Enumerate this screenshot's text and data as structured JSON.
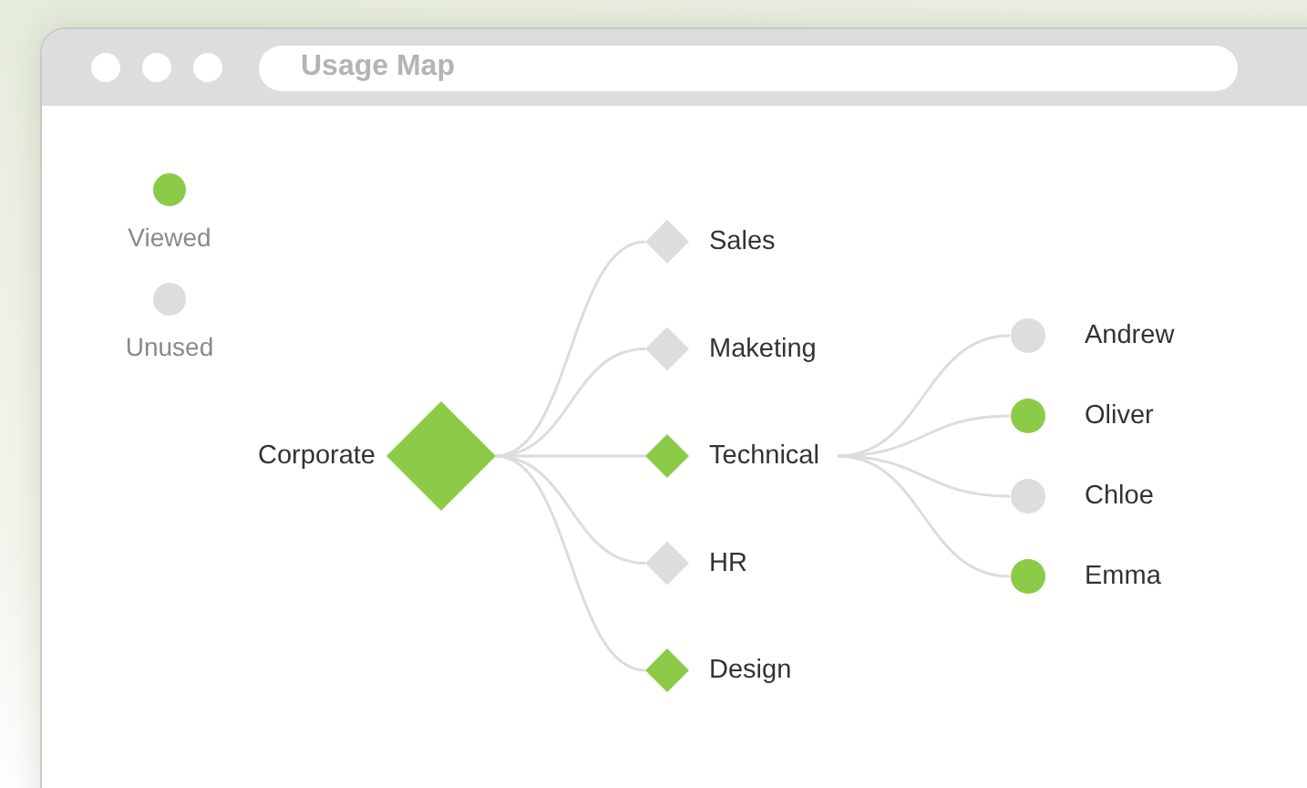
{
  "window": {
    "title": "Usage Map"
  },
  "legend": [
    {
      "label": "Viewed",
      "color": "#8bcb48"
    },
    {
      "label": "Unused",
      "color": "#dddddd"
    }
  ],
  "tree": {
    "label": "Corporate",
    "kind": "diamond",
    "viewed": true,
    "children": [
      {
        "label": "Sales",
        "kind": "diamond",
        "viewed": false
      },
      {
        "label": "Maketing",
        "kind": "diamond",
        "viewed": false
      },
      {
        "label": "Technical",
        "kind": "diamond",
        "viewed": true,
        "children": [
          {
            "label": "Andrew",
            "kind": "circle",
            "viewed": false
          },
          {
            "label": "Oliver",
            "kind": "circle",
            "viewed": true
          },
          {
            "label": "Chloe",
            "kind": "circle",
            "viewed": false
          },
          {
            "label": "Emma",
            "kind": "circle",
            "viewed": true
          }
        ]
      },
      {
        "label": "HR",
        "kind": "diamond",
        "viewed": false
      },
      {
        "label": "Design",
        "kind": "diamond",
        "viewed": true
      }
    ]
  }
}
